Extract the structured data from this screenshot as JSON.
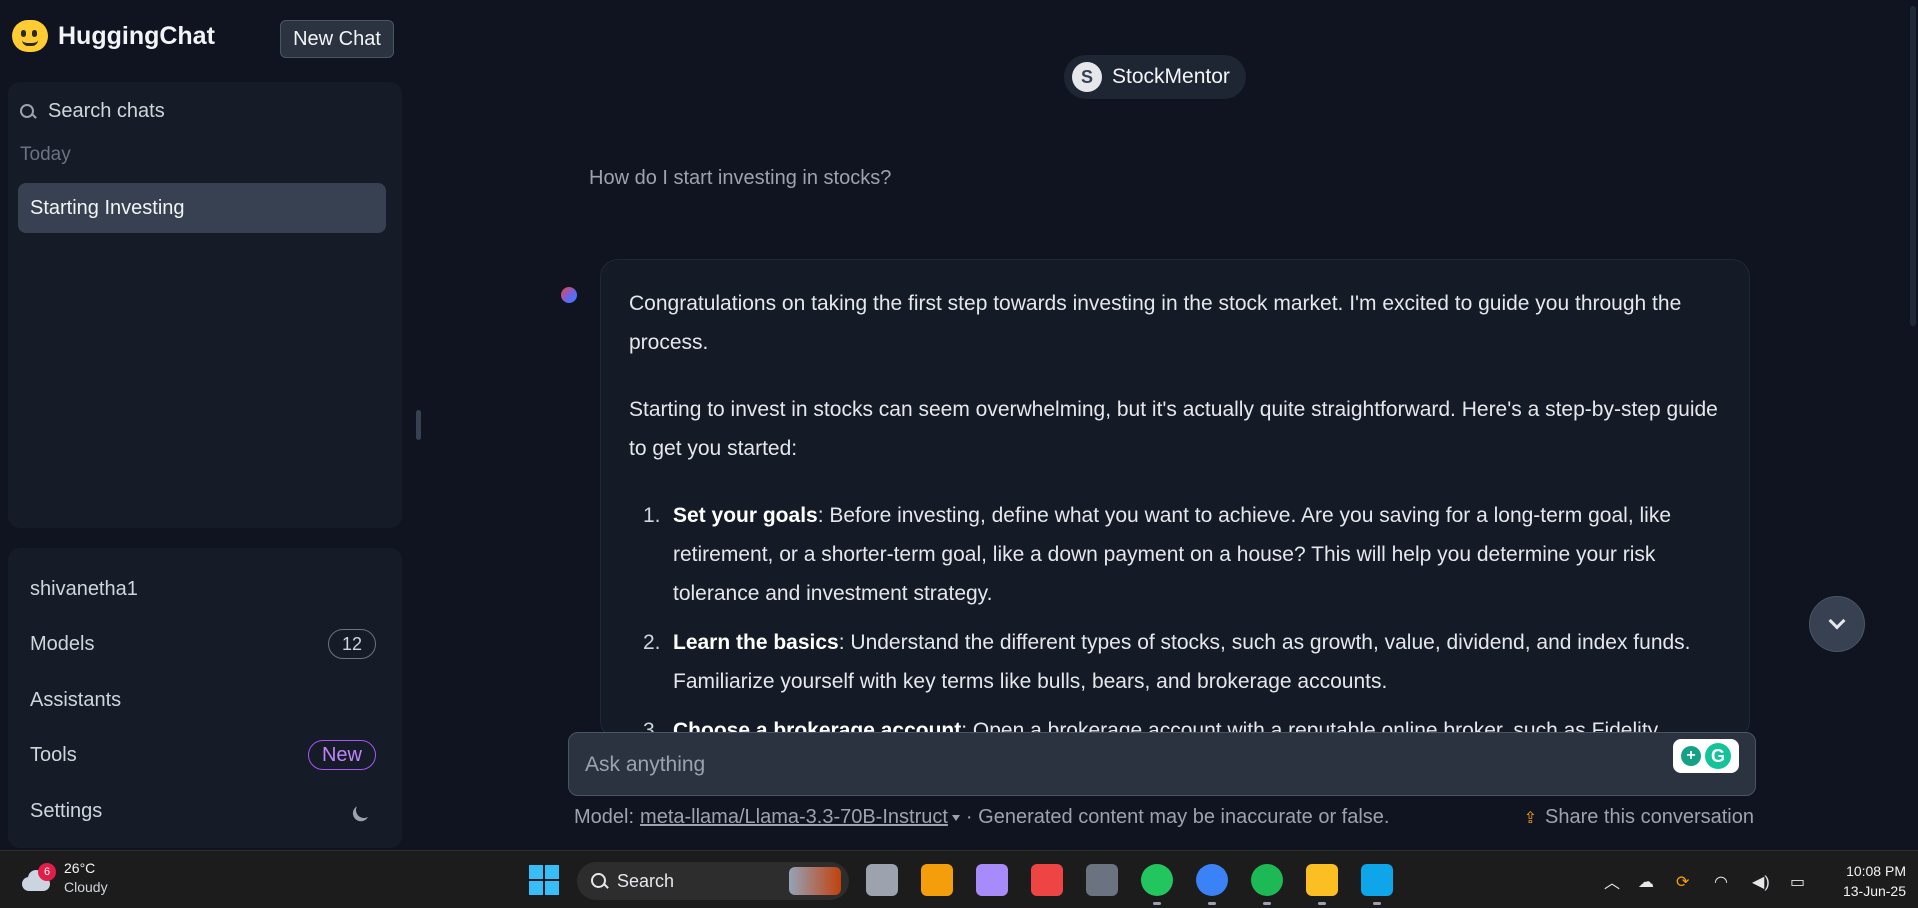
{
  "sidebar": {
    "brand": "HuggingChat",
    "new_chat_label": "New Chat",
    "search_label": "Search chats",
    "section_today": "Today",
    "chats": [
      "Starting Investing"
    ],
    "user": "shivanetha1",
    "models_label": "Models",
    "models_count": "12",
    "assistants_label": "Assistants",
    "tools_label": "Tools",
    "tools_badge": "New",
    "settings_label": "Settings"
  },
  "main": {
    "assistant_initial": "S",
    "assistant_name": "StockMentor",
    "user_message": "How do I start investing in stocks?",
    "answer": {
      "p1": "Congratulations on taking the first step towards investing in the stock market. I'm excited to guide you through the process.",
      "p2": "Starting to invest in stocks can seem overwhelming, but it's actually quite straightforward. Here's a step-by-step guide to get you started:",
      "items": [
        {
          "num": "1.",
          "title": "Set your goals",
          "text": ": Before investing, define what you want to achieve. Are you saving for a long-term goal, like retirement, or a shorter-term goal, like a down payment on a house? This will help you determine your risk tolerance and investment strategy."
        },
        {
          "num": "2.",
          "title": "Learn the basics",
          "text": ": Understand the different types of stocks, such as growth, value, dividend, and index funds. Familiarize yourself with key terms like bulls, bears, and brokerage accounts."
        },
        {
          "num": "3.",
          "title": "Choose a brokerage account",
          "text": ": Open a brokerage account with a reputable online broker, such as Fidelity,"
        }
      ]
    },
    "input_placeholder": "Ask anything",
    "footer": {
      "model_prefix": "Model:",
      "model_name": "meta-llama/Llama-3.3-70B-Instruct",
      "disclaimer": "· Generated content may be inaccurate or false.",
      "share_label": "Share this conversation"
    }
  },
  "taskbar": {
    "weather_temp": "26°C",
    "weather_desc": "Cloudy",
    "weather_badge": "6",
    "search_label": "Search",
    "time": "10:08 PM",
    "date": "13-Jun-25",
    "apps": [
      {
        "name": "task-view",
        "color": "#9ca3af"
      },
      {
        "name": "microsoft-store",
        "color": "#f59e0b"
      },
      {
        "name": "copilot",
        "color": "#a78bfa"
      },
      {
        "name": "snipping-tool",
        "color": "#ef4444"
      },
      {
        "name": "calculator",
        "color": "#6b7280"
      },
      {
        "name": "chrome",
        "color": "#22c55e"
      },
      {
        "name": "chrome-profile",
        "color": "#3b82f6"
      },
      {
        "name": "spotify",
        "color": "#1db954"
      },
      {
        "name": "file-explorer",
        "color": "#fbbf24"
      },
      {
        "name": "vscode",
        "color": "#0ea5e9"
      }
    ]
  }
}
